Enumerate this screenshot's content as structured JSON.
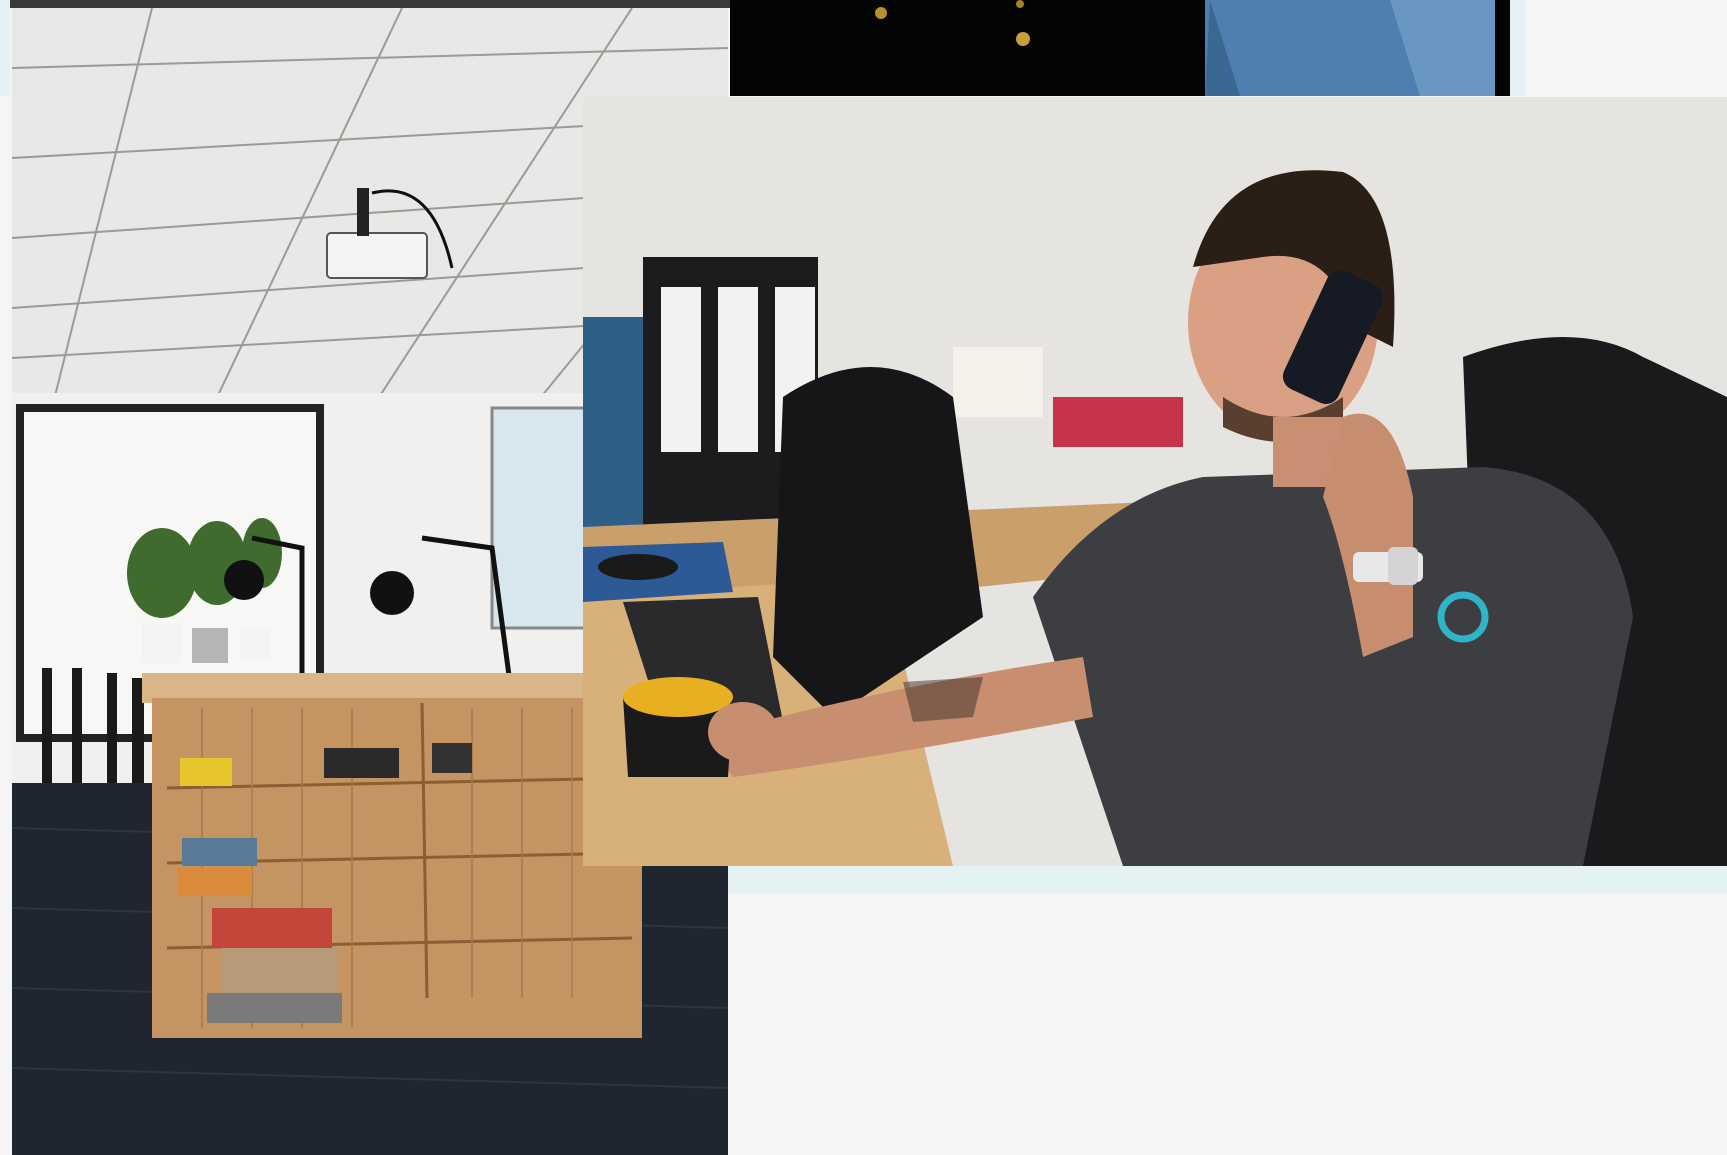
{
  "gallery": {
    "photos": [
      {
        "icon": "dark-clothing-photo",
        "subject": "top-cropped"
      },
      {
        "icon": "meeting-room-photo",
        "subject": "room"
      },
      {
        "icon": "man-on-phone-photo",
        "subject": "office"
      }
    ],
    "colors": {
      "background": "#f5f5f5",
      "accent": "#e3f3f3",
      "desk_wood": "#c9a070",
      "brand_teal": "#2fb5c8"
    }
  }
}
